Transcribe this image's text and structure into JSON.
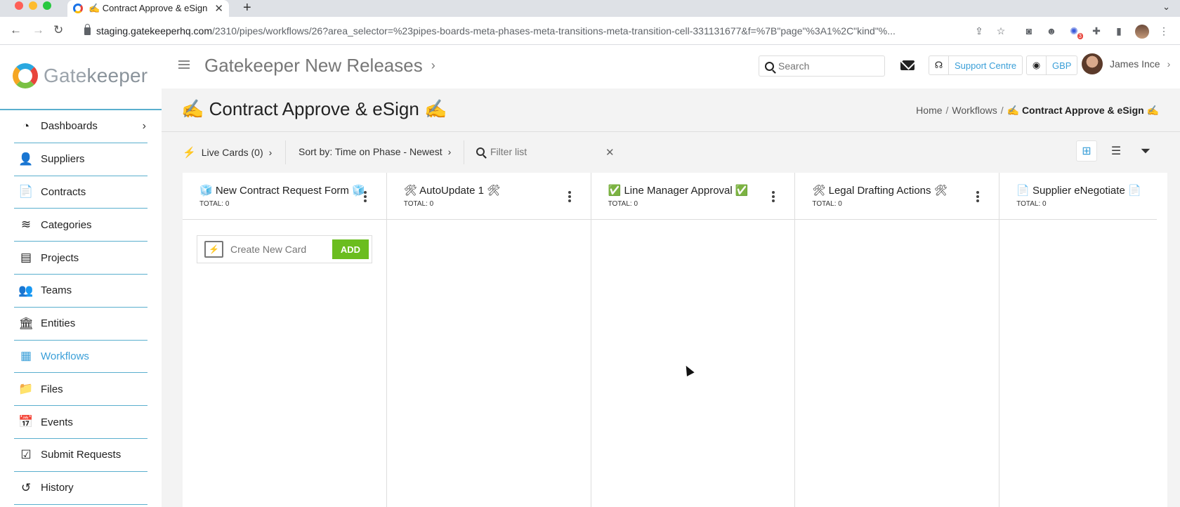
{
  "browser": {
    "tab_title": "✍️ Contract Approve & eSign ✍️",
    "new_tab": "+",
    "url_domain": "staging.gatekeeperhq.com",
    "url_path": "/2310/pipes/workflows/26?area_selector=%23pipes-boards-meta-phases-meta-transitions-meta-transition-cell-331131677&f=%7B\"page\"%3A1%2C\"kind\"%...",
    "extension_badge": "3"
  },
  "sidebar": {
    "logo_prefix": "Gate",
    "logo_suffix": "keeper",
    "items": [
      {
        "label": "Dashboards",
        "icon": "dashboard-icon"
      },
      {
        "label": "Suppliers",
        "icon": "suppliers-icon"
      },
      {
        "label": "Contracts",
        "icon": "contract-icon"
      },
      {
        "label": "Categories",
        "icon": "layers-icon"
      },
      {
        "label": "Projects",
        "icon": "projects-icon"
      },
      {
        "label": "Teams",
        "icon": "teams-icon"
      },
      {
        "label": "Entities",
        "icon": "bank-icon"
      },
      {
        "label": "Workflows",
        "icon": "workflow-grid-icon"
      },
      {
        "label": "Files",
        "icon": "folder-icon"
      },
      {
        "label": "Events",
        "icon": "calendar-icon"
      },
      {
        "label": "Submit Requests",
        "icon": "check-file-icon"
      },
      {
        "label": "History",
        "icon": "history-icon"
      }
    ],
    "active_item": "Workflows"
  },
  "topbar": {
    "org_title": "Gatekeeper New Releases",
    "search_placeholder": "Search",
    "support_label": "Support Centre",
    "currency_label": "GBP",
    "user_name": "James Ince"
  },
  "page": {
    "title": "✍️ Contract Approve & eSign ✍️",
    "breadcrumb": [
      "Home",
      "Workflows",
      "✍️ Contract Approve & eSign ✍️"
    ]
  },
  "toolbar": {
    "live_cards": "Live Cards (0)",
    "sort_by": "Sort by: Time on Phase - Newest",
    "filter_placeholder": "Filter list"
  },
  "board": {
    "columns": [
      {
        "title": "🧊 New Contract Request Form 🧊",
        "total": "TOTAL: 0"
      },
      {
        "title": "🛠 AutoUpdate 1  🛠",
        "total": "TOTAL: 0"
      },
      {
        "title": "✅ Line Manager Approval ✅",
        "total": "TOTAL: 0"
      },
      {
        "title": "🛠 Legal Drafting Actions 🛠",
        "total": "TOTAL: 0"
      },
      {
        "title": "📄 Supplier eNegotiate 📄",
        "total": "TOTAL: 0"
      }
    ],
    "new_card_placeholder": "Create New Card",
    "add_label": "ADD"
  },
  "colors": {
    "accent": "#3a9fd8",
    "add_button": "#6bbd1f",
    "divider": "#5aafce"
  }
}
